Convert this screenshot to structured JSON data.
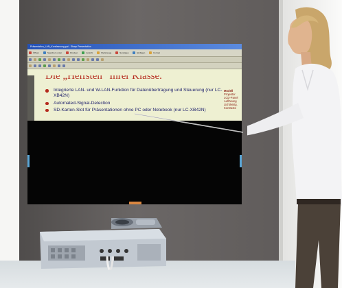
{
  "slide": {
    "window_title": "Präsentation_LAN_Kurzfassung.ppt - Sharp Presentation",
    "toolbar_items": [
      "Öffnen",
      "Speichern unter",
      "Drucken",
      "Ansicht",
      "Werkzeuge",
      "Sonstiges",
      "Einfügen",
      "Format"
    ],
    "title": "Die „Helfsten“ Ihrer Klasse.",
    "bullets": [
      "Integrierte LAN- und W-LAN-Funktion für Datenübertragung und Steuerung (nur LC-XB42N)",
      "Automated-Signal-Detection",
      "SD-Karten-Slot für Präsentationen ohne PC oder Notebook (nur LC-XB42N)"
    ],
    "side_note_lines": [
      "Modell",
      "Projektor",
      "LCD-Panel",
      "Auflösung",
      "Lichtleistg.",
      "Kontraste"
    ]
  },
  "colors": {
    "wall": "#5f5b5a",
    "slide_bg": "#eef0d2",
    "title": "#b52a1d",
    "bullet_text": "#1b1d6b",
    "projector_body": "#bfc6cf"
  }
}
